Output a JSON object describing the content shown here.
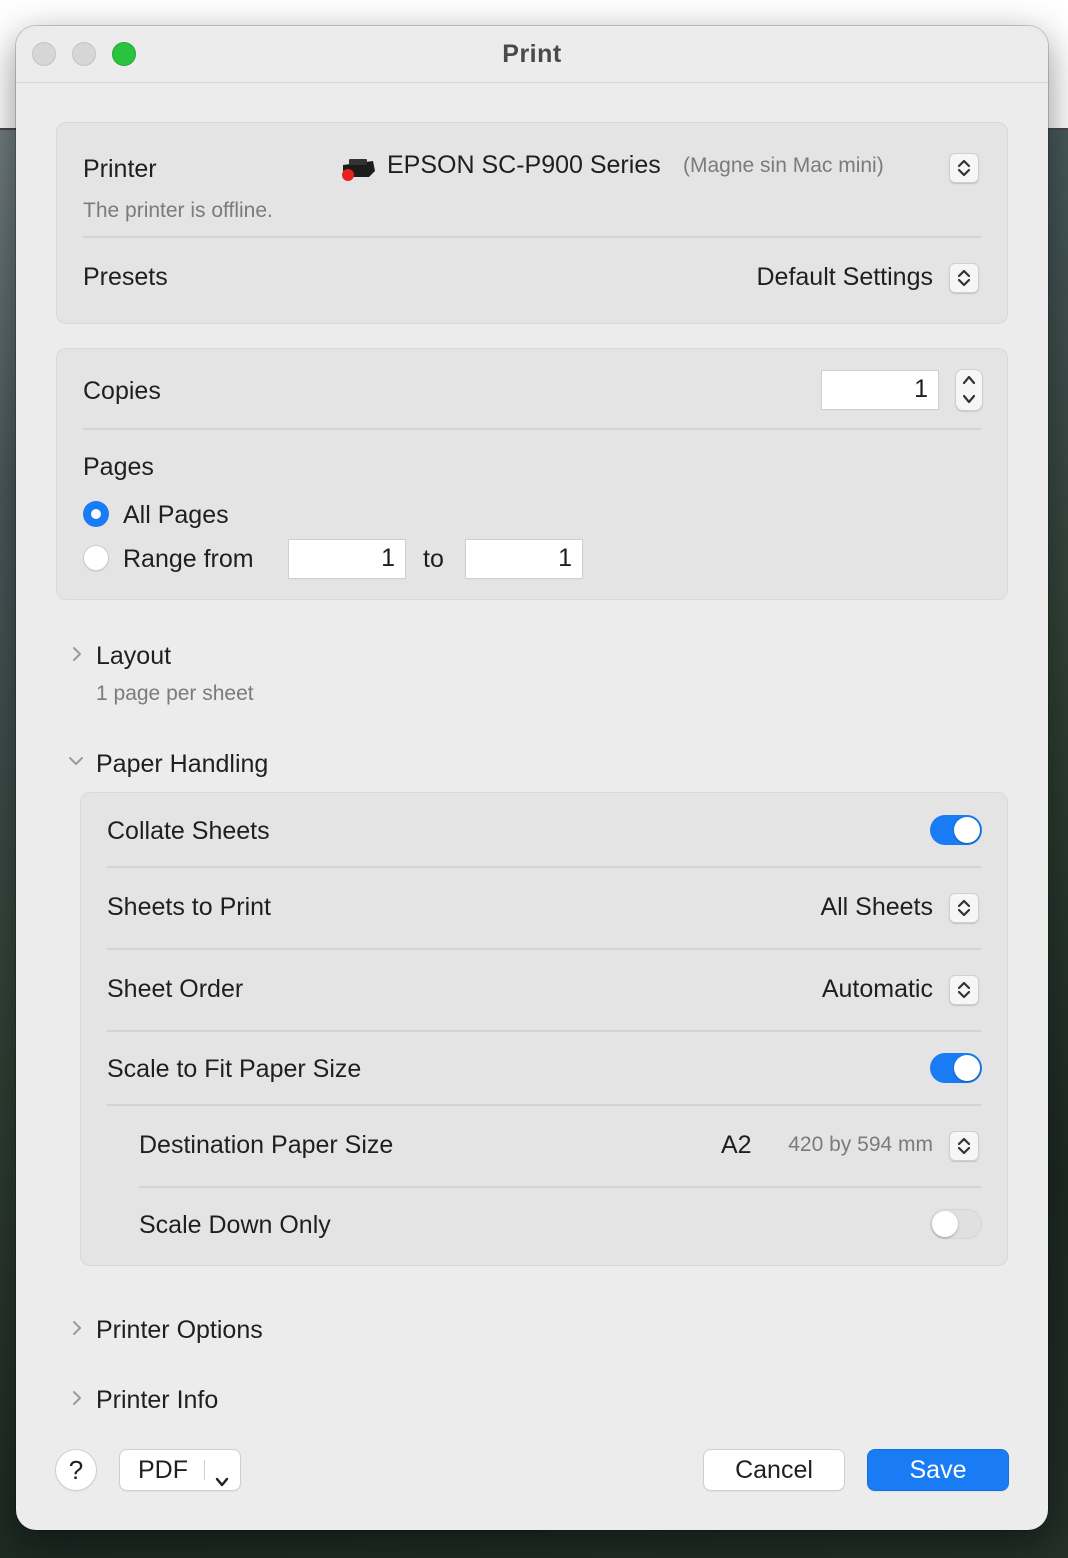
{
  "window": {
    "title": "Print"
  },
  "printer": {
    "label": "Printer",
    "name": "EPSON SC-P900 Series",
    "host": "(Magne sin Mac mini)",
    "status": "The printer is offline."
  },
  "presets": {
    "label": "Presets",
    "value": "Default Settings"
  },
  "copies": {
    "label": "Copies",
    "value": "1"
  },
  "pages": {
    "label": "Pages",
    "all_label": "All Pages",
    "all_selected": true,
    "range_label": "Range from",
    "range_from": "1",
    "range_to_label": "to",
    "range_to": "1"
  },
  "layout": {
    "label": "Layout",
    "summary": "1 page per sheet",
    "expanded": false
  },
  "paper_handling": {
    "label": "Paper Handling",
    "expanded": true,
    "collate": {
      "label": "Collate Sheets",
      "on": true
    },
    "sheets_to_print": {
      "label": "Sheets to Print",
      "value": "All Sheets"
    },
    "sheet_order": {
      "label": "Sheet Order",
      "value": "Automatic"
    },
    "scale_to_fit": {
      "label": "Scale to Fit Paper Size",
      "on": true
    },
    "destination_size": {
      "label": "Destination Paper Size",
      "value": "A2",
      "dimensions": "420 by 594 mm"
    },
    "scale_down_only": {
      "label": "Scale Down Only",
      "on": false
    }
  },
  "printer_options": {
    "label": "Printer Options",
    "expanded": false
  },
  "printer_info": {
    "label": "Printer Info",
    "expanded": false
  },
  "footer": {
    "help_label": "?",
    "pdf_label": "PDF",
    "cancel_label": "Cancel",
    "save_label": "Save"
  },
  "colors": {
    "accent": "#1a7cf5",
    "offline_indicator": "#e8201e"
  }
}
